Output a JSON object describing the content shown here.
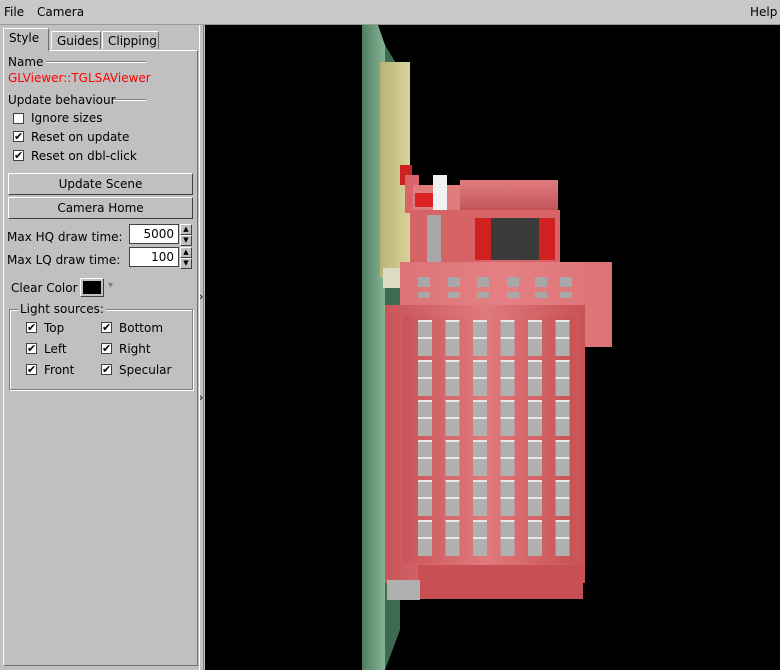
{
  "menu": {
    "file": "File",
    "camera": "Camera",
    "help": "Help"
  },
  "tabs": [
    "Style",
    "Guides",
    "Clipping"
  ],
  "name_label": "Name",
  "viewer_name": "GLViewer::TGLSAViewer",
  "update_behaviour_label": "Update behaviour",
  "options": {
    "ignore_sizes": {
      "label": "Ignore sizes",
      "checked": false
    },
    "reset_on_update": {
      "label": "Reset on update",
      "checked": true
    },
    "reset_on_dblclick": {
      "label": "Reset on dbl-click",
      "checked": true
    }
  },
  "buttons": {
    "update_scene": "Update Scene",
    "camera_home": "Camera Home"
  },
  "max_hq": {
    "label": "Max HQ draw time:",
    "value": "5000"
  },
  "max_lq": {
    "label": "Max LQ draw time:",
    "value": "100"
  },
  "clear_color": {
    "label": "Clear Color",
    "value": "#000000"
  },
  "light_sources": {
    "label": "Light sources:",
    "top": {
      "label": "Top",
      "checked": true
    },
    "bottom": {
      "label": "Bottom",
      "checked": true
    },
    "left": {
      "label": "Left",
      "checked": true
    },
    "right": {
      "label": "Right",
      "checked": true
    },
    "front": {
      "label": "Front",
      "checked": true
    },
    "specular": {
      "label": "Specular",
      "checked": true
    }
  },
  "check_mark": "✔",
  "icons": {
    "arrow_up": "▲",
    "arrow_down": "▼",
    "splitter_arrow": "›",
    "dropdown": "▾"
  },
  "colors": {
    "viewer_name": "#ff0000",
    "viewport_bg": "#000000",
    "model_red": "#d9666a"
  }
}
